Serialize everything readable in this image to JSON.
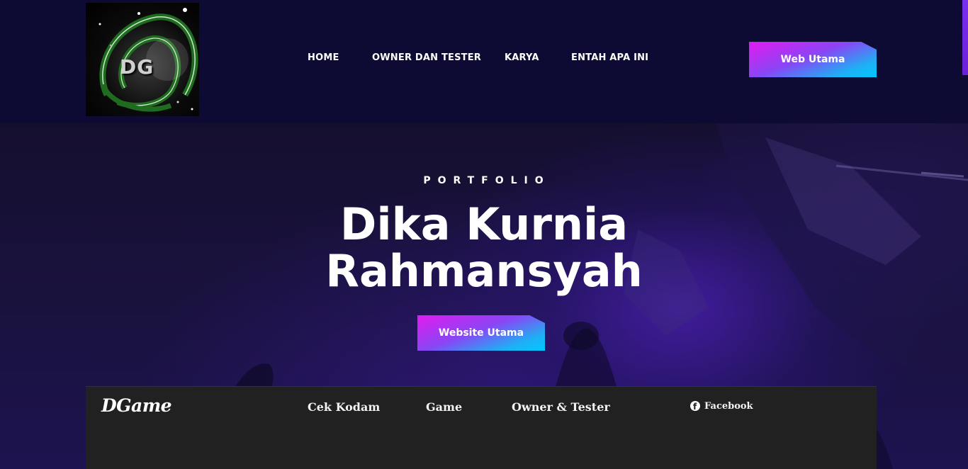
{
  "header": {
    "logo_text": "DG",
    "nav": [
      "HOME",
      "OWNER DAN TESTER",
      "KARYA",
      "ENTAH APA INI"
    ],
    "cta_label": "Web Utama"
  },
  "hero": {
    "subtitle": "PORTFOLIO",
    "title_line1": "Dika Kurnia",
    "title_line2": "Rahmansyah",
    "cta_label": "Website Utama"
  },
  "footer": {
    "brand": "DGame",
    "links": [
      "Cek Kodam",
      "Game",
      "Owner & Tester"
    ],
    "social_label": "Facebook",
    "social_icon": "facebook-icon"
  },
  "colors": {
    "header_bg": "#0d0a33",
    "hero_bg": "#1a1240",
    "cta_gradient_start": "#e21bf0",
    "cta_gradient_end": "#00c8ff",
    "footer_bg": "#212121"
  }
}
